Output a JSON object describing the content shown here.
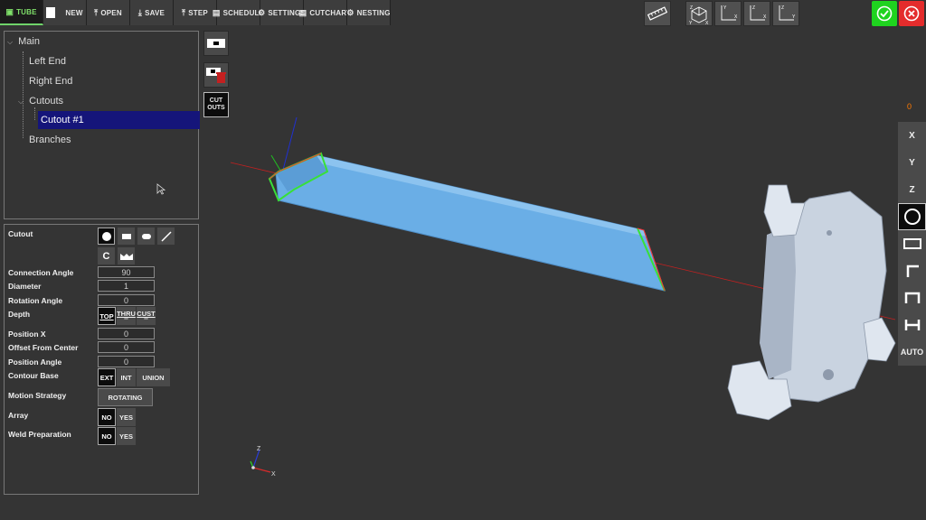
{
  "toolbar": {
    "tube": "TUBE",
    "new": "NEW",
    "open": "OPEN",
    "save": "SAVE",
    "step": "STEP",
    "schedule": "SCHEDULE",
    "settings": "SETTINGS",
    "cutchart": "CUTCHART",
    "nesting": "NESTING"
  },
  "tree": {
    "main": "Main",
    "left_end": "Left End",
    "right_end": "Right End",
    "cutouts": "Cutouts",
    "cutout1": "Cutout #1",
    "branches": "Branches"
  },
  "side_tools": {
    "cutouts": "CUT OUTS"
  },
  "props": {
    "cutout": "Cutout",
    "connection_angle": "Connection Angle",
    "connection_angle_value": "90",
    "diameter": "Diameter",
    "diameter_value": "1",
    "rotation_angle": "Rotation Angle",
    "rotation_angle_value": "0",
    "depth": "Depth",
    "depth_top": "TOP",
    "depth_thru": "THRU",
    "depth_cust": "CUST",
    "position_x": "Position X",
    "position_x_value": "0",
    "offset_center": "Offset From Center",
    "offset_center_value": "0",
    "position_angle": "Position Angle",
    "position_angle_value": "0",
    "contour_base": "Contour Base",
    "contour_ext": "EXT",
    "contour_int": "INT",
    "contour_union": "UNION",
    "motion_strategy": "Motion Strategy",
    "motion_value": "ROTATING",
    "array": "Array",
    "array_no": "NO",
    "array_yes": "YES",
    "weld_prep": "Weld Preparation",
    "weld_no": "NO",
    "weld_yes": "YES",
    "shape_c": "C"
  },
  "right_panel": {
    "counter": "0",
    "x": "X",
    "y": "Y",
    "z": "Z",
    "auto": "AUTO"
  },
  "axis_labels": {
    "x": "X",
    "y": "Y",
    "z": "Z"
  },
  "colors": {
    "accent": "#6fd36a",
    "ok": "#1fd31f",
    "cancel": "#e42c2c",
    "tube": "#6aaee6",
    "selection": "#15157a"
  }
}
